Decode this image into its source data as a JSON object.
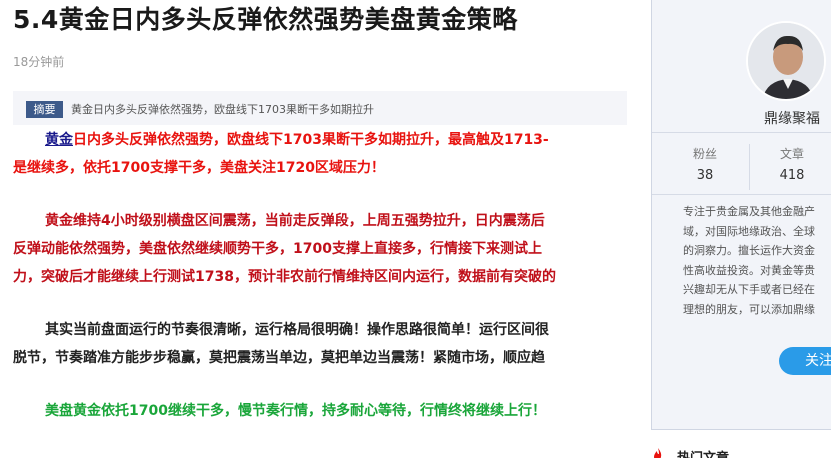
{
  "article": {
    "title": "5.4黄金日内多头反弹依然强势美盘黄金策略",
    "time": "18分钟前",
    "summary_tag": "摘要",
    "summary_text": "黄金日内多头反弹依然强势，欧盘线下1703果断干多如期拉升",
    "p1_keyword": "黄金",
    "p1_l1": "日内多头反弹依然强势，欧盘线下1703果断干多如期拉升，最高触及1713-",
    "p1_l2": "是继续多，依托1700支撑干多，美盘关注1720区域压力！",
    "p2_l1": "黄金维持4小时级别横盘区间震荡，当前走反弹段，上周五强势拉升，日内震荡后",
    "p2_l2": "反弹动能依然强势，美盘依然继续顺势干多，1700支撑上直接多，行情接下来测试上",
    "p2_l3": "力，突破后才能继续上行测试1738，预计非农前行情维持区间内运行，数据前有突破的",
    "p3_l1": "其实当前盘面运行的节奏很清晰，运行格局很明确！操作思路很简单！运行区间很",
    "p3_l2": "脱节，节奏踏准方能步步稳赢，莫把震荡当单边，莫把单边当震荡！紧随市场，顺应趋",
    "p4": "美盘黄金依托1700继续干多，慢节奏行情，持多耐心等待，行情终将继续上行！"
  },
  "profile": {
    "name": "鼎缘聚福",
    "fans_label": "粉丝",
    "fans_count": "38",
    "posts_label": "文章",
    "posts_count": "418",
    "bio_l1": "专注于贵金属及其他金融产",
    "bio_l2": "域，对国际地缘政治、全球",
    "bio_l3": "的洞察力。擅长运作大资金",
    "bio_l4": "性高收益投资。对黄金等贵",
    "bio_l5": "兴趣却无从下手或者已经在",
    "bio_l6": "理想的朋友，可以添加鼎缘",
    "follow_label": "关注"
  },
  "hot": {
    "label": "热门文章"
  },
  "colors": {
    "accent": "#2a9be8",
    "red_text": "#e8130f",
    "green_text": "#1aa63a",
    "tag_bg": "#3d5a8a"
  }
}
